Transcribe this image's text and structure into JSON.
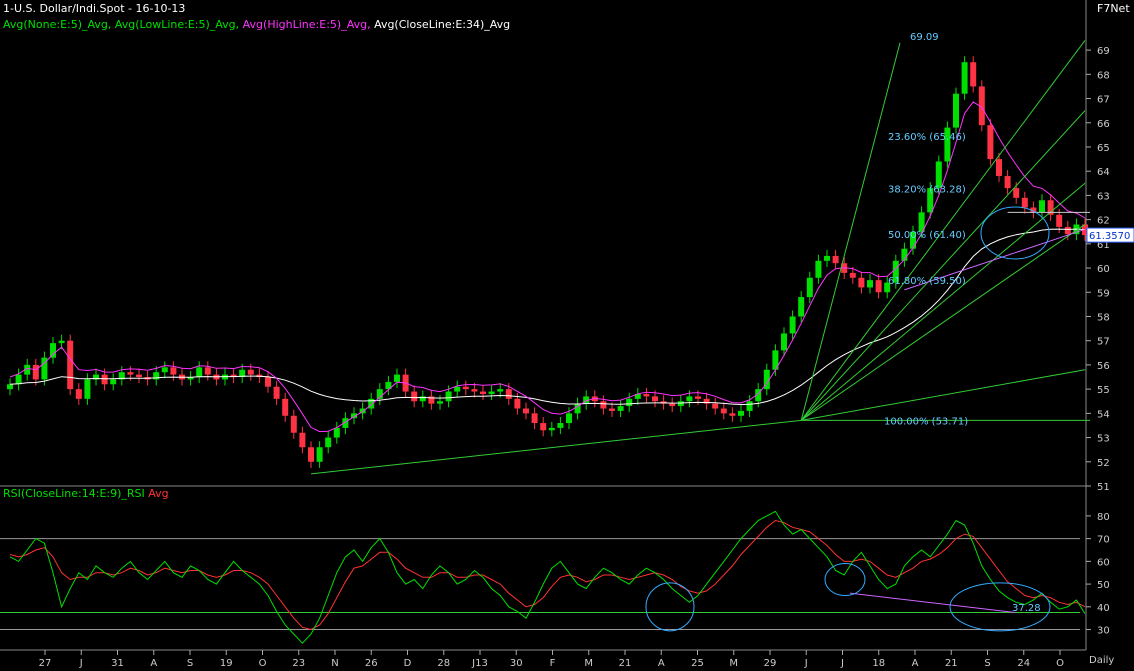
{
  "header": {
    "title": "1-U.S. Dollar/Indi.Spot - 16-10-13",
    "brand": "F7Net",
    "studies_main": [
      {
        "text": "Avg(None:E:5)_Avg,",
        "color": "#00e000"
      },
      {
        "text": "Avg(LowLine:E:5)_Avg,",
        "color": "#00e000"
      },
      {
        "text": "Avg(HighLine:E:5)_Avg,",
        "color": "#ff33ff"
      },
      {
        "text": "Avg(CloseLine:E:34)_Avg",
        "color": "#ffffff"
      }
    ],
    "studies_rsi": [
      {
        "text": "RSI(CloseLine:14:E:9)_RSI",
        "color": "#00e000"
      },
      {
        "text": "Avg",
        "color": "#ff3333"
      }
    ],
    "periodicity": "Daily"
  },
  "chart_data": [
    {
      "type": "candlestick",
      "title": "1-U.S. Dollar/Indi.Spot - 16-10-13",
      "ylim": [
        51,
        69.5
      ],
      "yticks": [
        51,
        52,
        53,
        54,
        55,
        56,
        57,
        58,
        59,
        60,
        61,
        62,
        63,
        64,
        65,
        66,
        67,
        68,
        69
      ],
      "xticks": [
        "27",
        "J",
        "31",
        "A",
        "S",
        "19",
        "O",
        "23",
        "N",
        "26",
        "D",
        "28",
        "J13",
        "30",
        "F",
        "M",
        "21",
        "A",
        "25",
        "M",
        "29",
        "J",
        "J",
        "18",
        "A",
        "21",
        "S",
        "24",
        "O"
      ],
      "last_value_label": "61.3570",
      "close": [
        55.2,
        55.6,
        56.0,
        55.4,
        56.3,
        56.9,
        57.0,
        55.0,
        54.6,
        55.4,
        55.6,
        55.2,
        55.4,
        55.7,
        55.6,
        55.5,
        55.4,
        55.7,
        55.9,
        55.6,
        55.4,
        55.5,
        55.9,
        55.6,
        55.4,
        55.6,
        55.5,
        55.8,
        55.6,
        55.5,
        55.1,
        54.6,
        53.9,
        53.2,
        52.6,
        52.0,
        52.6,
        53.0,
        53.4,
        53.8,
        54.0,
        54.2,
        54.6,
        55.0,
        55.3,
        55.6,
        54.9,
        54.5,
        54.7,
        54.4,
        54.5,
        54.9,
        55.1,
        55.0,
        54.9,
        54.8,
        54.9,
        55.0,
        54.6,
        54.2,
        54.0,
        53.6,
        53.3,
        53.4,
        53.6,
        54.0,
        54.4,
        54.7,
        54.5,
        54.2,
        54.1,
        54.3,
        54.6,
        54.8,
        54.7,
        54.5,
        54.4,
        54.3,
        54.5,
        54.7,
        54.6,
        54.4,
        54.2,
        54.0,
        53.9,
        54.1,
        54.5,
        55.0,
        55.8,
        56.6,
        57.3,
        58.0,
        58.8,
        59.6,
        60.3,
        60.5,
        60.2,
        59.8,
        59.6,
        59.2,
        59.5,
        59.0,
        59.4,
        60.3,
        60.8,
        61.5,
        62.3,
        63.3,
        64.4,
        65.8,
        67.2,
        68.5,
        67.5,
        65.9,
        64.5,
        63.8,
        63.3,
        62.9,
        62.5,
        62.3,
        62.8,
        62.2,
        61.7,
        61.4,
        61.8,
        61.36
      ],
      "levels": [
        {
          "label": "100.00% (53.71)",
          "value": 53.71
        },
        {
          "label": "61.80% (59.50)",
          "value": 59.5
        },
        {
          "label": "50.00% (61.40)",
          "value": 61.4
        },
        {
          "label": "38.20% (63.28)",
          "value": 63.28
        },
        {
          "label": "23.60% (65.46)",
          "value": 65.46
        },
        {
          "label": "69.09",
          "value": 69.09
        }
      ]
    },
    {
      "type": "line",
      "title": "RSI(CloseLine:14:E:9)_RSI Avg",
      "ylim": [
        21,
        87
      ],
      "yticks": [
        30,
        40,
        50,
        60,
        70,
        80
      ],
      "hlines": [
        30,
        70
      ],
      "support_line": 37.5,
      "last_value_label": "37.28",
      "series": [
        {
          "name": "RSI",
          "color": "#00e000",
          "values": [
            62,
            60,
            65,
            70,
            68,
            55,
            40,
            48,
            55,
            52,
            58,
            55,
            53,
            57,
            60,
            55,
            52,
            56,
            60,
            55,
            53,
            58,
            56,
            52,
            50,
            55,
            60,
            56,
            53,
            50,
            45,
            38,
            32,
            28,
            24,
            28,
            35,
            45,
            55,
            62,
            65,
            60,
            66,
            70,
            64,
            55,
            50,
            52,
            48,
            54,
            58,
            55,
            50,
            52,
            56,
            53,
            48,
            45,
            40,
            38,
            35,
            42,
            50,
            57,
            60,
            55,
            50,
            48,
            53,
            57,
            55,
            52,
            50,
            54,
            57,
            55,
            52,
            48,
            45,
            42,
            45,
            50,
            55,
            60,
            65,
            70,
            74,
            78,
            80,
            82,
            76,
            72,
            74,
            70,
            66,
            62,
            56,
            54,
            60,
            64,
            58,
            52,
            48,
            50,
            58,
            62,
            65,
            62,
            67,
            72,
            78,
            76,
            68,
            58,
            52,
            47,
            44,
            42,
            41,
            43,
            46,
            42,
            39,
            40,
            43,
            37
          ]
        },
        {
          "name": "Avg",
          "color": "#ff3333",
          "values": [
            63,
            62,
            63,
            65,
            66,
            62,
            55,
            52,
            53,
            53,
            55,
            55,
            54,
            55,
            57,
            56,
            54,
            55,
            57,
            56,
            55,
            56,
            56,
            54,
            53,
            54,
            56,
            56,
            55,
            53,
            50,
            45,
            40,
            35,
            31,
            30,
            32,
            37,
            44,
            51,
            57,
            58,
            61,
            64,
            64,
            61,
            57,
            55,
            53,
            53,
            55,
            55,
            53,
            53,
            54,
            54,
            52,
            50,
            46,
            43,
            40,
            41,
            44,
            49,
            53,
            54,
            53,
            51,
            52,
            54,
            54,
            53,
            52,
            53,
            54,
            55,
            54,
            52,
            49,
            47,
            46,
            47,
            50,
            54,
            58,
            63,
            67,
            71,
            75,
            78,
            77,
            75,
            74,
            73,
            70,
            67,
            63,
            60,
            60,
            61,
            60,
            57,
            54,
            53,
            55,
            57,
            60,
            61,
            63,
            66,
            70,
            72,
            71,
            66,
            61,
            56,
            51,
            48,
            45,
            44,
            45,
            44,
            42,
            41,
            42,
            40
          ]
        }
      ]
    }
  ]
}
